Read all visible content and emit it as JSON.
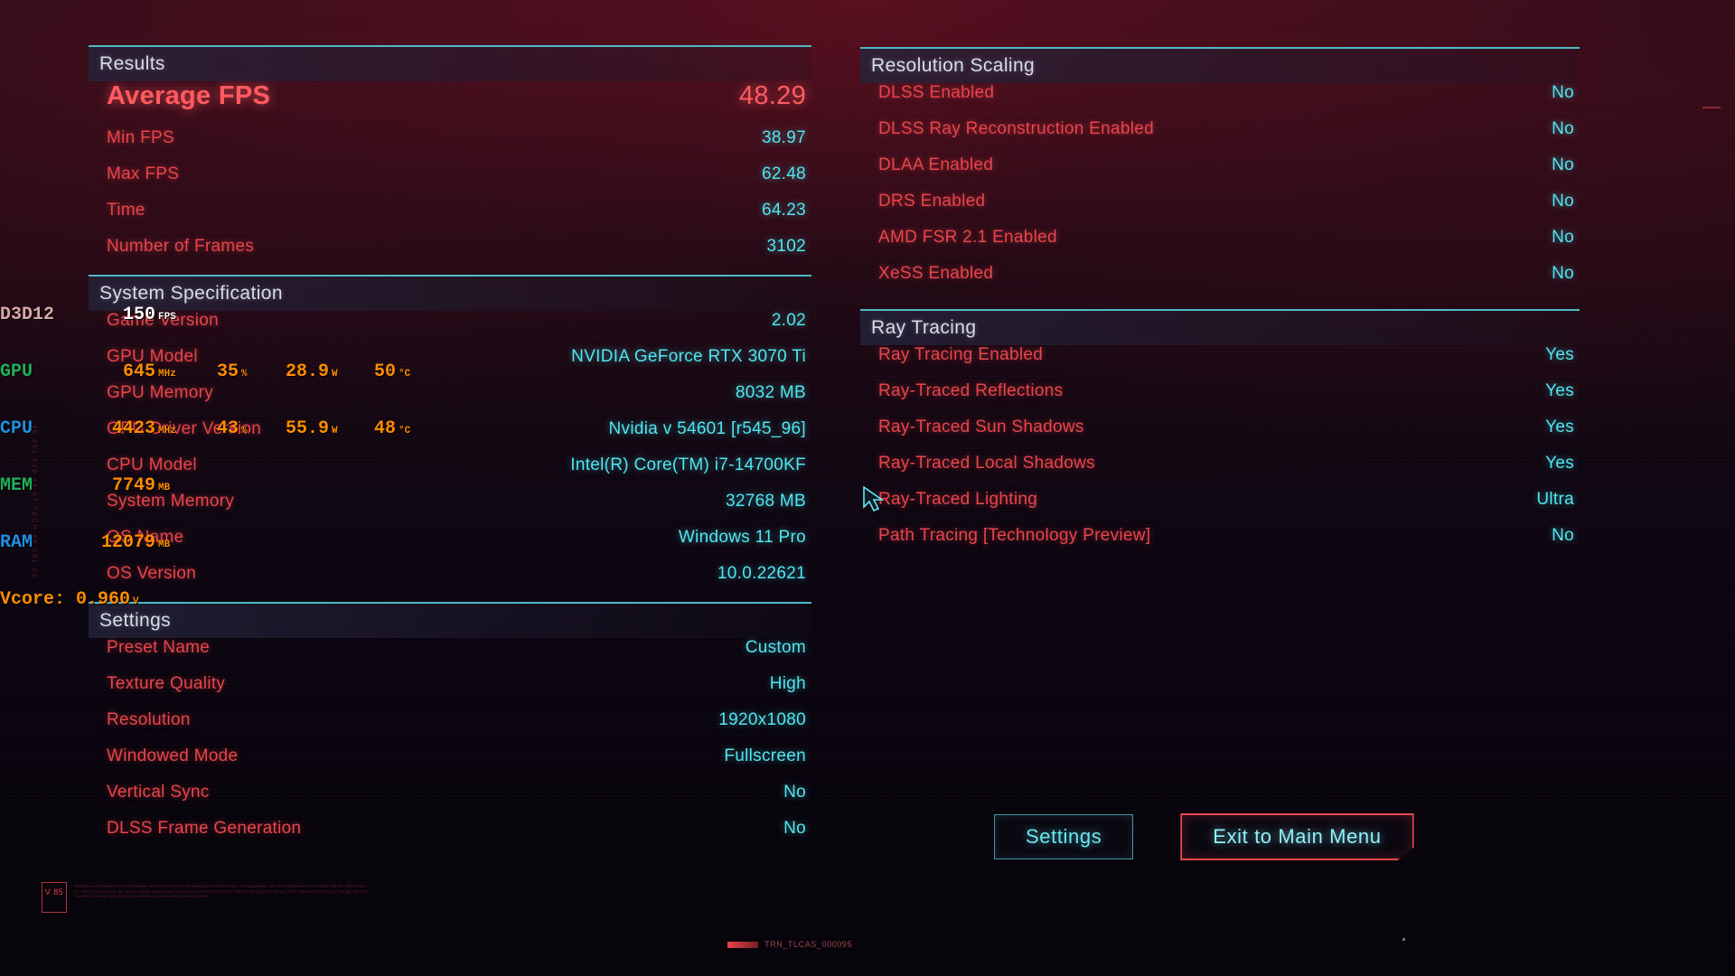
{
  "sections": {
    "results": {
      "title": "Results",
      "rows": [
        {
          "label": "Average FPS",
          "value": "48.29",
          "hero": true
        },
        {
          "label": "Min FPS",
          "value": "38.97"
        },
        {
          "label": "Max FPS",
          "value": "62.48"
        },
        {
          "label": "Time",
          "value": "64.23"
        },
        {
          "label": "Number of Frames",
          "value": "3102"
        }
      ]
    },
    "system_specification": {
      "title": "System Specification",
      "rows": [
        {
          "label": "Game Version",
          "value": "2.02"
        },
        {
          "label": "GPU Model",
          "value": "NVIDIA GeForce RTX 3070 Ti"
        },
        {
          "label": "GPU Memory",
          "value": "8032 MB"
        },
        {
          "label": "GPU Driver Version",
          "value": "Nvidia v 54601 [r545_96]"
        },
        {
          "label": "CPU Model",
          "value": "Intel(R) Core(TM) i7-14700KF"
        },
        {
          "label": "System Memory",
          "value": "32768 MB"
        },
        {
          "label": "OS Name",
          "value": "Windows 11 Pro"
        },
        {
          "label": "OS Version",
          "value": "10.0.22621"
        }
      ]
    },
    "settings": {
      "title": "Settings",
      "rows": [
        {
          "label": "Preset Name",
          "value": "Custom"
        },
        {
          "label": "Texture Quality",
          "value": "High"
        },
        {
          "label": "Resolution",
          "value": "1920x1080"
        },
        {
          "label": "Windowed Mode",
          "value": "Fullscreen"
        },
        {
          "label": "Vertical Sync",
          "value": "No"
        },
        {
          "label": "DLSS Frame Generation",
          "value": "No"
        }
      ]
    },
    "resolution_scaling": {
      "title": "Resolution Scaling",
      "rows": [
        {
          "label": "DLSS Enabled",
          "value": "No"
        },
        {
          "label": "DLSS Ray Reconstruction Enabled",
          "value": "No"
        },
        {
          "label": "DLAA Enabled",
          "value": "No"
        },
        {
          "label": "DRS Enabled",
          "value": "No"
        },
        {
          "label": "AMD FSR 2.1 Enabled",
          "value": "No"
        },
        {
          "label": "XeSS Enabled",
          "value": "No"
        }
      ]
    },
    "ray_tracing": {
      "title": "Ray Tracing",
      "rows": [
        {
          "label": "Ray Tracing Enabled",
          "value": "Yes"
        },
        {
          "label": "Ray-Traced Reflections",
          "value": "Yes"
        },
        {
          "label": "Ray-Traced Sun Shadows",
          "value": "Yes"
        },
        {
          "label": "Ray-Traced Local Shadows",
          "value": "Yes"
        },
        {
          "label": "Ray-Traced Lighting",
          "value": "Ultra"
        },
        {
          "label": "Path Tracing [Technology Preview]",
          "value": "No"
        }
      ]
    }
  },
  "buttons": {
    "settings": "Settings",
    "exit_to_main_menu": "Exit to Main Menu"
  },
  "overlay": {
    "api": {
      "label": "D3D12",
      "value": "150",
      "unit": "FPS"
    },
    "gpu": {
      "label": "GPU",
      "clock": "645",
      "clock_unit": "MHz",
      "usage": "35",
      "usage_unit": "%",
      "power": "28.9",
      "power_unit": "W",
      "temp": "50",
      "temp_unit": "°C"
    },
    "cpu": {
      "label": "CPU",
      "clock": "4423",
      "clock_unit": "MHz",
      "usage": "43",
      "usage_unit": "%",
      "power": "55.9",
      "power_unit": "W",
      "temp": "48",
      "temp_unit": "°C"
    },
    "mem": {
      "label": "MEM",
      "value": "7749",
      "unit": "MB"
    },
    "ram": {
      "label": "RAM",
      "value": "12079",
      "unit": "MB"
    },
    "vcore": {
      "text": "Vcore: 0.960",
      "unit": "V"
    }
  },
  "hud": {
    "watermark": "V\n85",
    "legal": "This data was obtained at an initial hardware and also be used for the develop and achieved video. Non-parametric data will be performed in accordance with the GMO Project, Inc. GMO is documented, act, and the relative material and in accordance with every brand. In 1996 also the guidelines for any of the measured recovery and carriage Survival Foundation. Neither apply for local permission to access neither used to operate.",
    "code_strip": "TRN_TLCAS_000095",
    "side_ticks": "36 392 018    43 47 TECH    45 091 23"
  },
  "colors": {
    "accent_red": "#e8444a",
    "accent_cyan": "#4fe6ef",
    "header_line": "#4fb9c4",
    "hero_red": "#ff5a5f",
    "osd_orange": "#ff8c00"
  }
}
